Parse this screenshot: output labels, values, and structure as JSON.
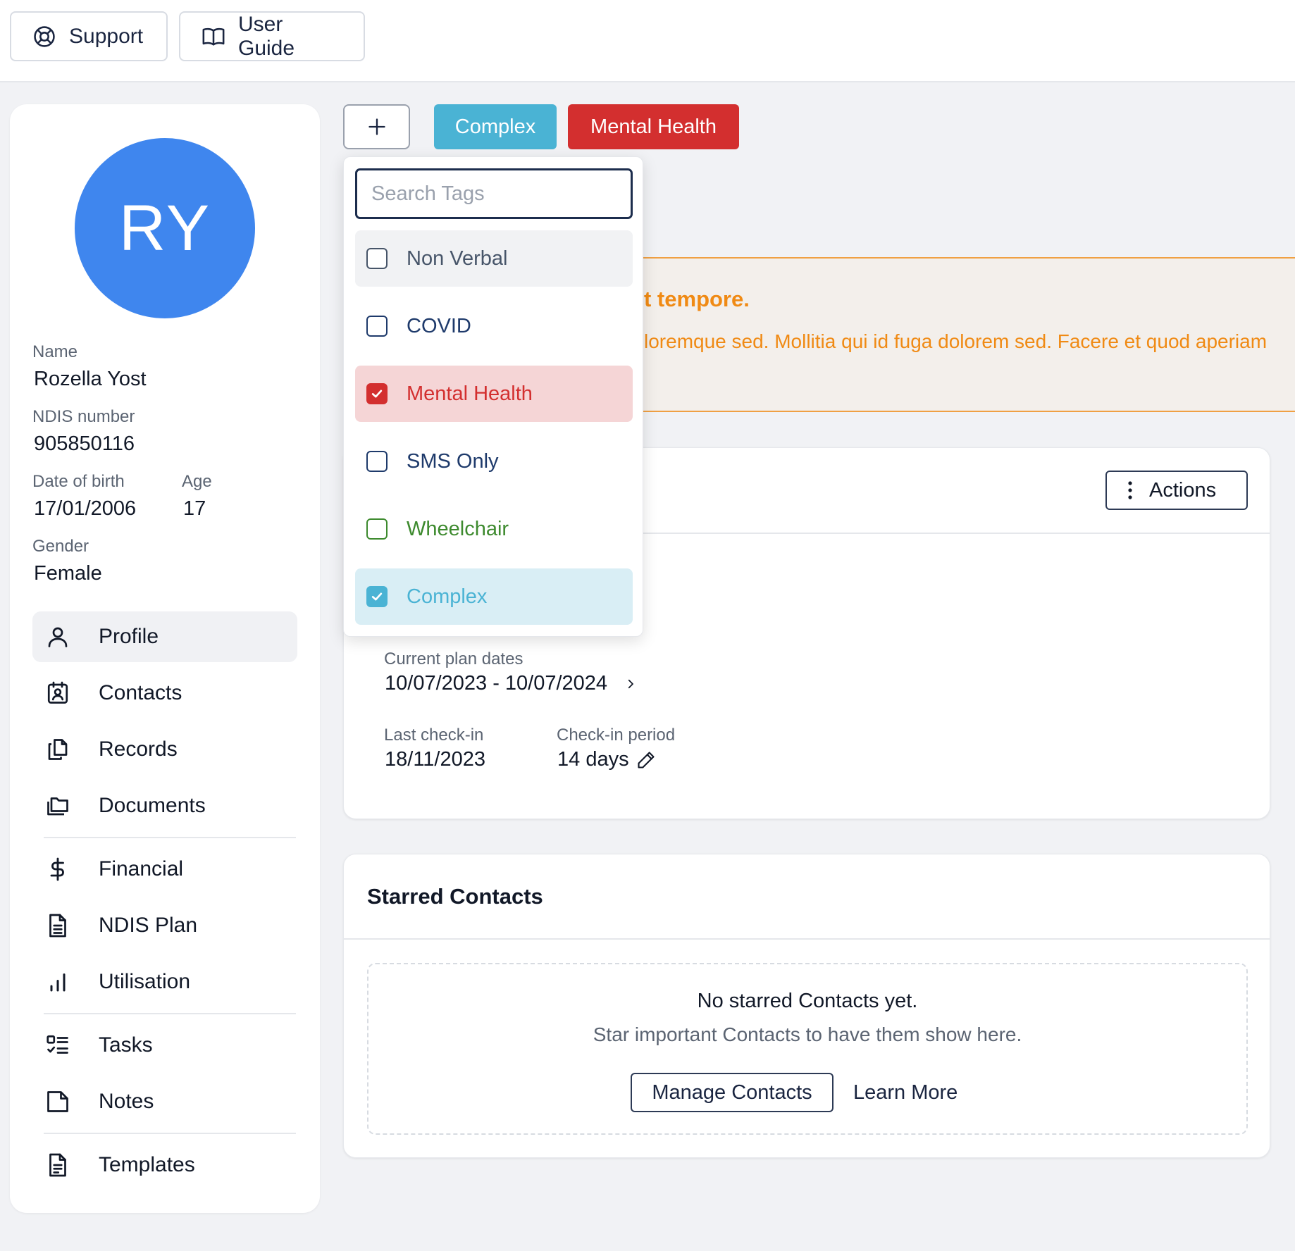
{
  "topbar": {
    "support_label": "Support",
    "user_guide_label": "User Guide"
  },
  "profile": {
    "initials": "RY",
    "name_label": "Name",
    "name": "Rozella Yost",
    "ndis_label": "NDIS number",
    "ndis": "905850116",
    "dob_label": "Date of birth",
    "dob": "17/01/2006",
    "age_label": "Age",
    "age": "17",
    "gender_label": "Gender",
    "gender": "Female"
  },
  "nav": {
    "items": [
      {
        "label": "Profile",
        "icon": "user-icon",
        "active": true
      },
      {
        "label": "Contacts",
        "icon": "contact-card-icon"
      },
      {
        "label": "Records",
        "icon": "records-icon"
      },
      {
        "label": "Documents",
        "icon": "folders-icon"
      },
      {
        "label": "Financial",
        "icon": "dollar-icon"
      },
      {
        "label": "NDIS Plan",
        "icon": "document-icon"
      },
      {
        "label": "Utilisation",
        "icon": "bar-chart-icon"
      },
      {
        "label": "Tasks",
        "icon": "task-list-icon"
      },
      {
        "label": "Notes",
        "icon": "note-icon"
      },
      {
        "label": "Templates",
        "icon": "template-icon"
      }
    ]
  },
  "tags": {
    "selected": [
      {
        "label": "Complex",
        "color": "#4ab3d4"
      },
      {
        "label": "Mental Health",
        "color": "#d32f2f"
      }
    ]
  },
  "tag_dropdown": {
    "search_placeholder": "Search Tags",
    "options": [
      {
        "label": "Non Verbal",
        "checked": false,
        "color": "#475569"
      },
      {
        "label": "COVID",
        "checked": false,
        "color": "#1e3a6b"
      },
      {
        "label": "Mental Health",
        "checked": true,
        "color": "#d32f2f"
      },
      {
        "label": "SMS Only",
        "checked": false,
        "color": "#1e3a6b"
      },
      {
        "label": "Wheelchair",
        "checked": false,
        "color": "#3d8a2e"
      },
      {
        "label": "Complex",
        "checked": true,
        "color": "#4ab3d4"
      }
    ]
  },
  "alert": {
    "title": "t tempore.",
    "text": "loremque sed. Mollitia qui id fuga dolorem sed. Facere et quod aperiam"
  },
  "plan_card": {
    "actions_label": "Actions",
    "plan_dates_label": "Current plan dates",
    "plan_dates": "10/07/2023 - 10/07/2024",
    "last_checkin_label": "Last check-in",
    "last_checkin": "18/11/2023",
    "checkin_period_label": "Check-in period",
    "checkin_period": "14 days"
  },
  "starred_contacts": {
    "title": "Starred Contacts",
    "empty_title": "No starred Contacts yet.",
    "empty_subtitle": "Star important Contacts to have them show here.",
    "manage_label": "Manage Contacts",
    "learn_more_label": "Learn More"
  }
}
